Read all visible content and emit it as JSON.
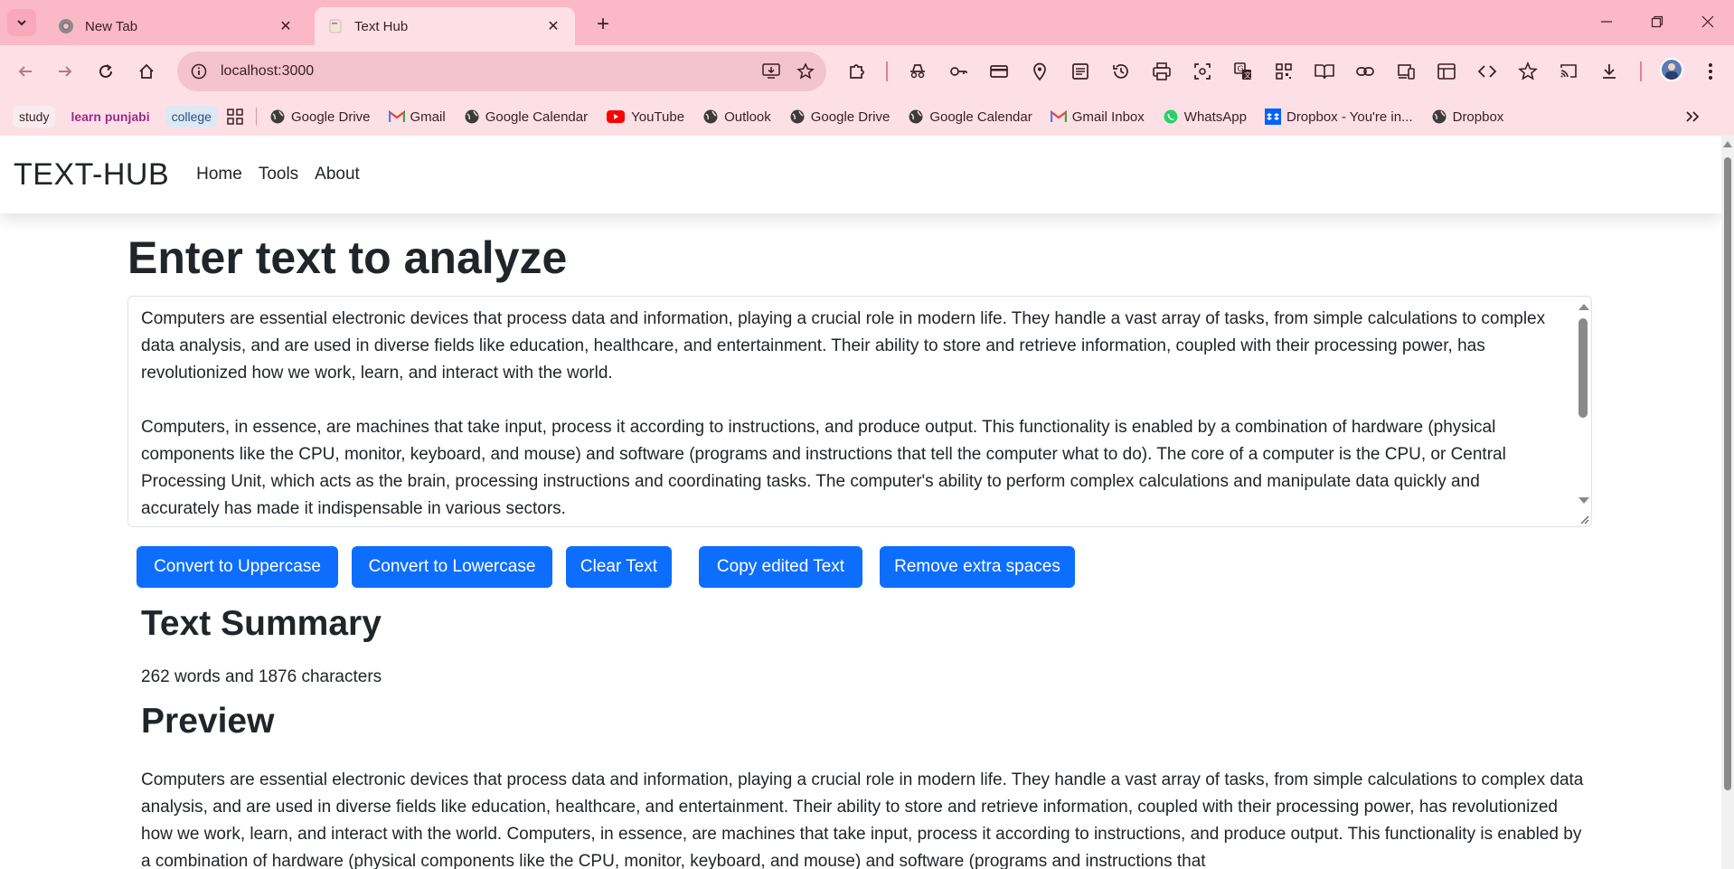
{
  "browser": {
    "tabs": [
      {
        "title": "New Tab"
      },
      {
        "title": "Text Hub"
      }
    ],
    "url": "localhost:3000",
    "bookmarks": {
      "chips": [
        "study",
        "learn punjabi",
        "college"
      ],
      "items": [
        {
          "label": "Google Drive",
          "icon": "globe-icon"
        },
        {
          "label": "Gmail",
          "icon": "gmail-icon"
        },
        {
          "label": "Google Calendar",
          "icon": "globe-icon"
        },
        {
          "label": "YouTube",
          "icon": "youtube-icon"
        },
        {
          "label": "Outlook",
          "icon": "globe-icon"
        },
        {
          "label": "Google Drive",
          "icon": "globe-icon"
        },
        {
          "label": "Google Calendar",
          "icon": "globe-icon"
        },
        {
          "label": "Gmail Inbox",
          "icon": "gmail-icon"
        },
        {
          "label": "WhatsApp",
          "icon": "whatsapp-icon"
        },
        {
          "label": "Dropbox - You're in...",
          "icon": "dropbox-icon"
        },
        {
          "label": "Dropbox",
          "icon": "globe-icon"
        }
      ]
    },
    "colors": {
      "chrome": "#fbb8c6",
      "toolbar": "#fde0e6"
    }
  },
  "navbar": {
    "brand": "TEXT-HUB",
    "links": [
      "Home",
      "Tools",
      "About"
    ]
  },
  "main": {
    "heading": "Enter text to analyze",
    "textarea": {
      "paragraph1": "Computers are essential electronic devices that process data and information, playing a crucial role in modern life. They handle a vast array of tasks, from simple calculations to complex data analysis, and are used in diverse fields like education, healthcare, and entertainment. Their ability to store and retrieve information, coupled with their processing power, has revolutionized how we work, learn, and interact with the world.",
      "paragraph2": "Computers, in essence, are machines that take input, process it according to instructions, and produce output. This functionality is enabled by a combination of hardware (physical components like the CPU, monitor, keyboard, and mouse) and software (programs and instructions that tell the computer what to do). The core of a computer is the CPU, or Central Processing Unit, which acts as the brain, processing instructions and coordinating tasks. The computer's ability to perform complex calculations and manipulate data quickly and accurately has made it indispensable in various sectors."
    },
    "buttons": {
      "uppercase": "Convert to Uppercase",
      "lowercase": "Convert to Lowercase",
      "clear": "Clear Text",
      "copy": "Copy edited Text",
      "remove_spaces": "Remove extra spaces"
    },
    "button_color": "#0d6efd",
    "summary": {
      "heading": "Text Summary",
      "text": "262 words and 1876 characters"
    },
    "preview": {
      "heading": "Preview",
      "text": "Computers are essential electronic devices that process data and information, playing a crucial role in modern life. They handle a vast array of tasks, from simple calculations to complex data analysis, and are used in diverse fields like education, healthcare, and entertainment. Their ability to store and retrieve information, coupled with their processing power, has revolutionized how we work, learn, and interact with the world. Computers, in essence, are machines that take input, process it according to instructions, and produce output. This functionality is enabled by a combination of hardware (physical components like the CPU, monitor, keyboard, and mouse) and software (programs and instructions that"
    }
  }
}
